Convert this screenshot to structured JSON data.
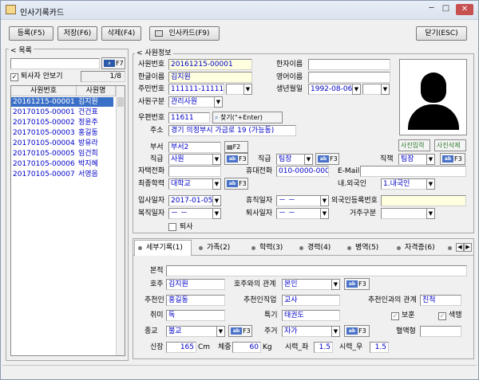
{
  "window": {
    "title": "인사기록카드",
    "min": "─",
    "max": "□",
    "close": "✕"
  },
  "toolbar": {
    "register": "등록(F5)",
    "save": "저장(F6)",
    "delete": "삭제(F4)",
    "print": "인사카드(F9)",
    "close": "닫기(ESC)"
  },
  "list_panel": {
    "legend": "목록",
    "search_btn": "F7",
    "show_retired": "퇴사자 안보기",
    "page": "1/8",
    "col_id": "사원번호",
    "col_name": "사원명",
    "rows": [
      {
        "id": "20161215-00001",
        "name": "김지원"
      },
      {
        "id": "20170105-00001",
        "name": "건건표"
      },
      {
        "id": "20170105-00002",
        "name": "정윤주"
      },
      {
        "id": "20170105-00003",
        "name": "홍길동"
      },
      {
        "id": "20170105-00004",
        "name": "방유라"
      },
      {
        "id": "20170105-00005",
        "name": "임건희"
      },
      {
        "id": "20170105-00006",
        "name": "박지혜"
      },
      {
        "id": "20170105-00007",
        "name": "서영음"
      }
    ]
  },
  "info": {
    "legend": "사원정보",
    "emp_no_label": "사원번호",
    "emp_no": "20161215-00001",
    "hanja_label": "한자이름",
    "hanja": "",
    "kor_name_label": "한글이름",
    "kor_name": "김지원",
    "eng_name_label": "영어이름",
    "eng_name": "",
    "ssn_label": "주민번호",
    "ssn": "111111-1111111",
    "birth_label": "생년월일",
    "birth": "1992-08-06",
    "emp_type_label": "사원구분",
    "emp_type": "관리사원",
    "zip_label": "우편번호",
    "zip": "11611",
    "find_btn": "찾기(\"+Enter)",
    "addr_label": "주소",
    "addr": "경기 의정부시 가금로 19 (가능동)",
    "dept_label": "부서",
    "dept": "부서2",
    "dept_btn": "F2",
    "grade_label": "직급",
    "grade": "사원",
    "rank_label": "직급",
    "rank": "팀장",
    "title_label": "직책",
    "title": "팀장",
    "home_tel_label": "자택전화",
    "home_tel": "",
    "mobile_label": "휴대전화",
    "mobile": "010-0000-0000",
    "email_label": "E-Mail",
    "email": "",
    "edu_label": "최종학력",
    "edu": "대학교",
    "nation_label": "내.외국인",
    "nation": "1.내국인",
    "join_label": "입사일자",
    "join": "2017-01-05",
    "leave_label": "휴직일자",
    "leave": "－ －",
    "foreign_no_label": "외국인등록번호",
    "foreign_no": "",
    "return_label": "복직일자",
    "return": "－ －",
    "resign_label": "퇴사일자",
    "resign": "－ －",
    "residence_label": "거주구분",
    "residence": "",
    "retired_label": "퇴사",
    "f3": "F3",
    "photo_in": "사진입력",
    "photo_del": "사진삭제"
  },
  "tabs": [
    "세부기록(1)",
    "가족(2)",
    "학력(3)",
    "경력(4)",
    "병역(5)",
    "자격증(6)"
  ],
  "detail": {
    "origin_label": "본적",
    "origin": "",
    "head_label": "호주",
    "head": "김지원",
    "relation_label": "호주와의 관계",
    "relation": "본인",
    "referrer_label": "추천인",
    "referrer": "홍길동",
    "ref_job_label": "추천인직업",
    "ref_job": "교사",
    "ref_rel_label": "추천인과의 관계",
    "ref_rel": "친척",
    "hobby_label": "취미",
    "hobby": "독",
    "skill_label": "특기",
    "skill": "태권도",
    "veteran_label": "보훈",
    "color_label": "색맹",
    "religion_label": "종교",
    "religion": "불교",
    "house_label": "주거",
    "house": "자가",
    "blood_label": "혈액형",
    "blood": "",
    "height_label": "신장",
    "height": "165",
    "cm": "Cm",
    "weight_label": "체중",
    "weight": "60",
    "kg": "Kg",
    "eye_l_label": "시력_좌",
    "eye_l": "1.5",
    "eye_r_label": "시력_우",
    "eye_r": "1.5"
  }
}
